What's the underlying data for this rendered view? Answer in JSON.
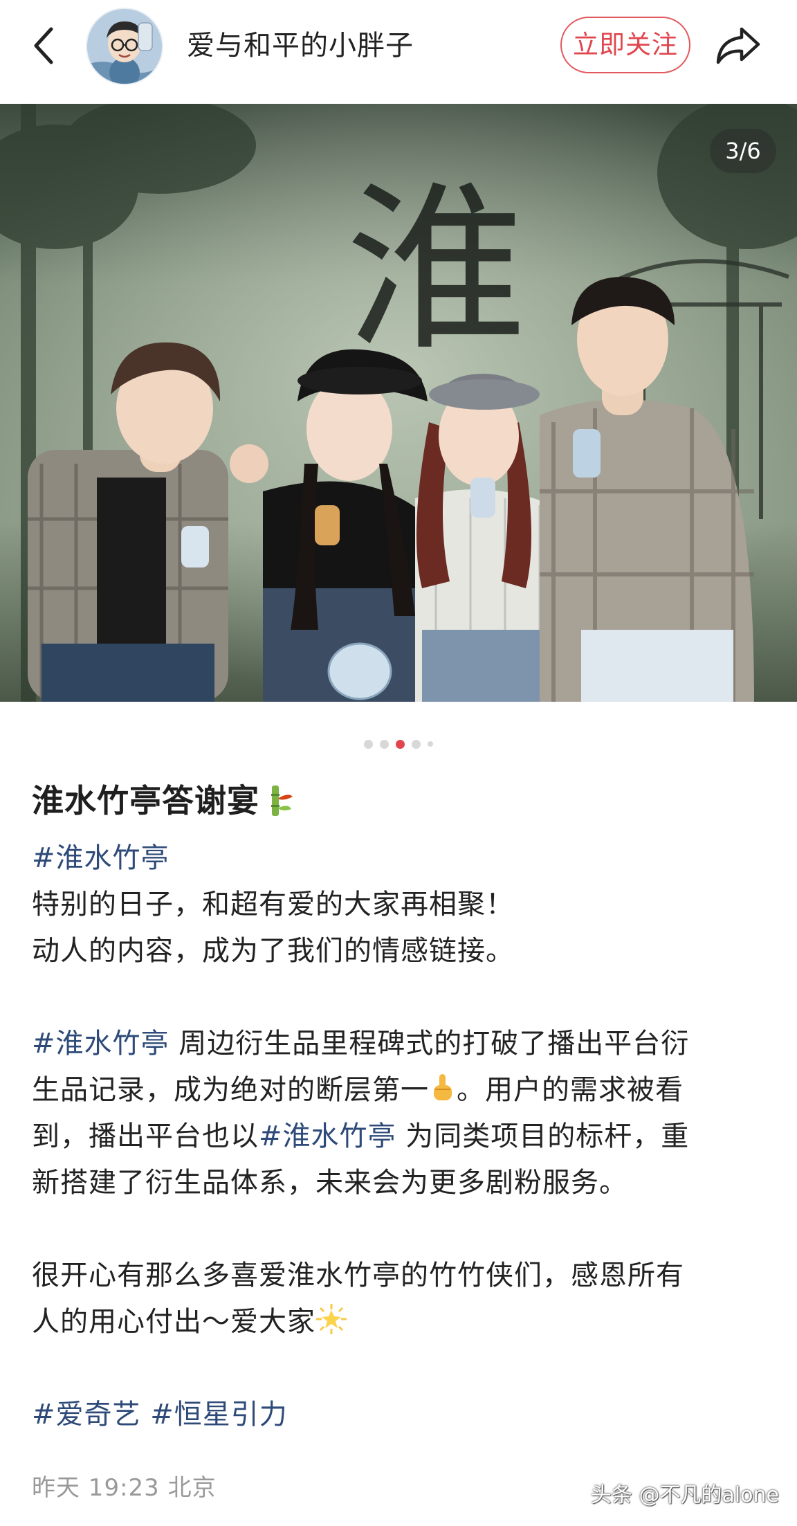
{
  "header": {
    "username": "爱与和平的小胖子",
    "follow_label": "立即关注"
  },
  "photo": {
    "counter": "3/6",
    "backdrop_glyph": "淮"
  },
  "pager": {
    "total": 5,
    "active_index": 2
  },
  "post": {
    "title": "淮水竹亭答谢宴",
    "title_emoji": "bamboo-emoji",
    "lines": {
      "tag1": "#淮水竹亭",
      "l1": "特别的日子，和超有爱的大家再相聚！",
      "l2": "动人的内容，成为了我们的情感链接。",
      "p2_tag": "#淮水竹亭",
      "p2_a": " 周边衍生品里程碑式的打破了播出平台衍",
      "p2_b": "生品记录，成为绝对的断层第一",
      "p2_c": "。用户的需求被看",
      "p2_d": "到，播出平台也以",
      "p2_tag2": "#淮水竹亭",
      "p2_e": " 为同类项目的标杆，重",
      "p2_f": "新搭建了衍生品体系，未来会为更多剧粉服务。",
      "p3_a": "很开心有那么多喜爱淮水竹亭的竹竹侠们，感恩所有",
      "p3_b": "人的用心付出～爱大家",
      "tag_a": "#爱奇艺",
      "tag_b": "#恒星引力"
    }
  },
  "footer": {
    "time": "昨天 19:23",
    "location": "北京",
    "watermark": "头条 @不凡的alone"
  },
  "colors": {
    "accent": "#e1464e",
    "tag": "#2d4a78",
    "meta": "#999999"
  }
}
